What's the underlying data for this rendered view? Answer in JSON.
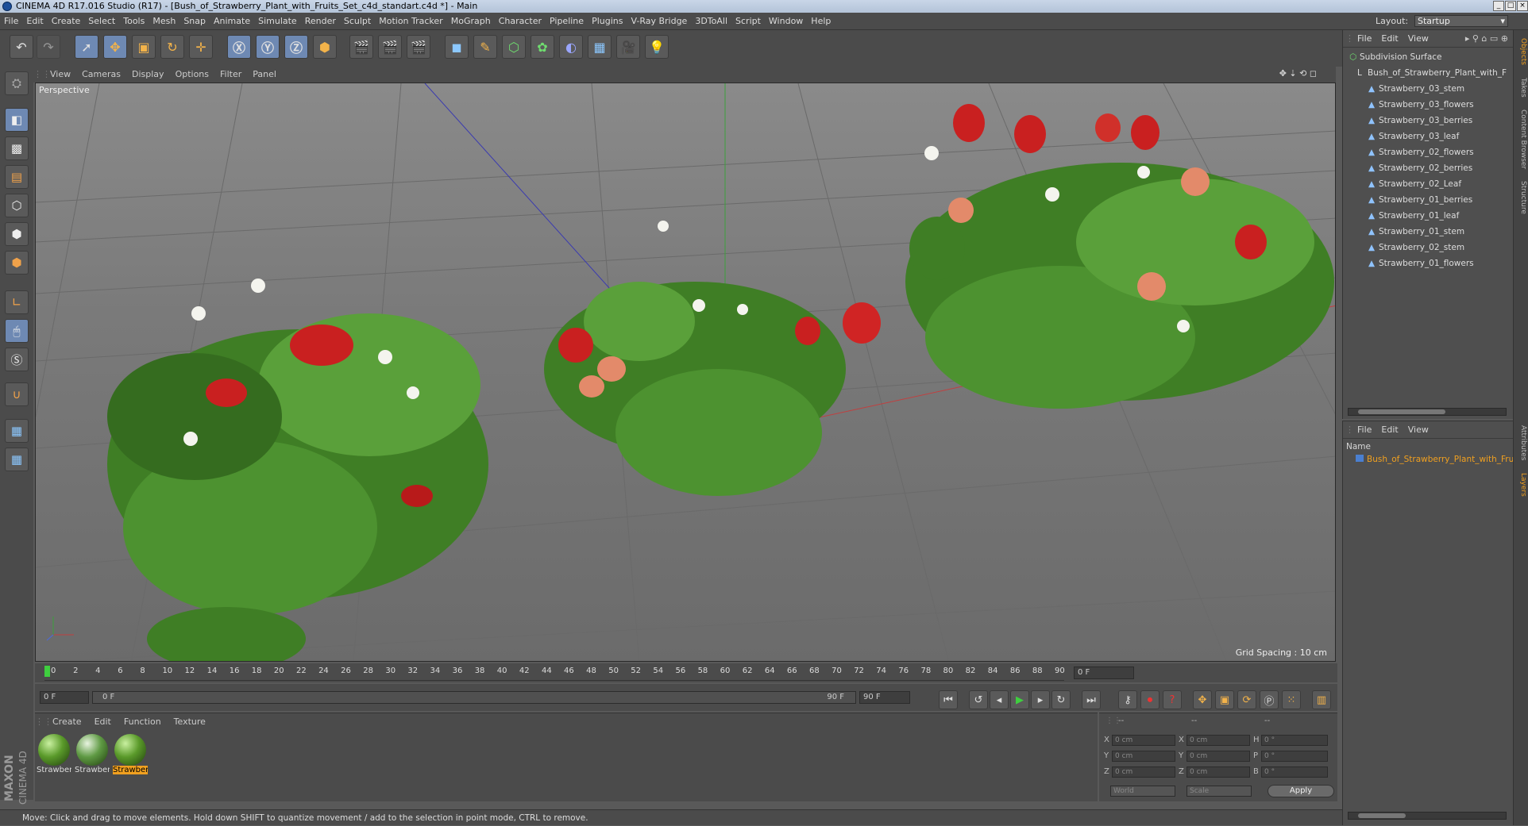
{
  "window": {
    "title": "CINEMA 4D R17.016 Studio (R17) - [Bush_of_Strawberry_Plant_with_Fruits_Set_c4d_standart.c4d *] - Main"
  },
  "menu": [
    "File",
    "Edit",
    "Create",
    "Select",
    "Tools",
    "Mesh",
    "Snap",
    "Animate",
    "Simulate",
    "Render",
    "Sculpt",
    "Motion Tracker",
    "MoGraph",
    "Character",
    "Pipeline",
    "Plugins",
    "V-Ray Bridge",
    "3DToAll",
    "Script",
    "Window",
    "Help"
  ],
  "layout": {
    "label": "Layout:",
    "value": "Startup"
  },
  "viewport": {
    "menu": [
      "View",
      "Cameras",
      "Display",
      "Options",
      "Filter",
      "Panel"
    ],
    "name": "Perspective",
    "grid_spacing": "Grid Spacing : 10 cm"
  },
  "timeline": {
    "ticks": [
      "0",
      "2",
      "4",
      "6",
      "8",
      "10",
      "12",
      "14",
      "16",
      "18",
      "20",
      "22",
      "24",
      "26",
      "28",
      "30",
      "32",
      "34",
      "36",
      "38",
      "40",
      "42",
      "44",
      "46",
      "48",
      "50",
      "52",
      "54",
      "56",
      "58",
      "60",
      "62",
      "64",
      "66",
      "68",
      "70",
      "72",
      "74",
      "76",
      "78",
      "80",
      "82",
      "84",
      "86",
      "88",
      "90"
    ],
    "current": "0 F",
    "start": "0 F",
    "range_start": "0 F",
    "range_end": "90 F",
    "end": "90 F"
  },
  "materials": {
    "menu": [
      "Create",
      "Edit",
      "Function",
      "Texture"
    ],
    "items": [
      {
        "name": "Strawber"
      },
      {
        "name": "Strawber"
      },
      {
        "name": "Strawber"
      }
    ]
  },
  "coords": {
    "headers": [
      "--",
      "--",
      "--"
    ],
    "x": "0 cm",
    "y": "0 cm",
    "z": "0 cm",
    "sx": "0 cm",
    "sy": "0 cm",
    "sz": "0 cm",
    "h": "0 °",
    "p": "0 °",
    "b": "0 °",
    "mode1": "World",
    "mode2": "Scale",
    "apply": "Apply",
    "labels": {
      "X": "X",
      "Y": "Y",
      "Z": "Z",
      "H": "H",
      "P": "P",
      "B": "B"
    }
  },
  "status": "Move: Click and drag to move elements. Hold down SHIFT to quantize movement / add to the selection in point mode, CTRL to remove.",
  "objects": {
    "menu": [
      "File",
      "Edit",
      "View"
    ],
    "items": [
      "Subdivision Surface",
      "Bush_of_Strawberry_Plant_with_F",
      "Strawberry_03_stem",
      "Strawberry_03_flowers",
      "Strawberry_03_berries",
      "Strawberry_03_leaf",
      "Strawberry_02_flowers",
      "Strawberry_02_berries",
      "Strawberry_02_Leaf",
      "Strawberry_01_berries",
      "Strawberry_01_leaf",
      "Strawberry_01_stem",
      "Strawberry_02_stem",
      "Strawberry_01_flowers"
    ]
  },
  "layers": {
    "menu": [
      "File",
      "Edit",
      "View"
    ],
    "header": "Name",
    "item": "Bush_of_Strawberry_Plant_with_Fru"
  },
  "sidetabs": [
    "Objects",
    "Takes",
    "Content Browser",
    "Structure",
    "Attributes",
    "Layers"
  ],
  "brand": {
    "maxon": "MAXON",
    "cinema": "CINEMA 4D"
  }
}
